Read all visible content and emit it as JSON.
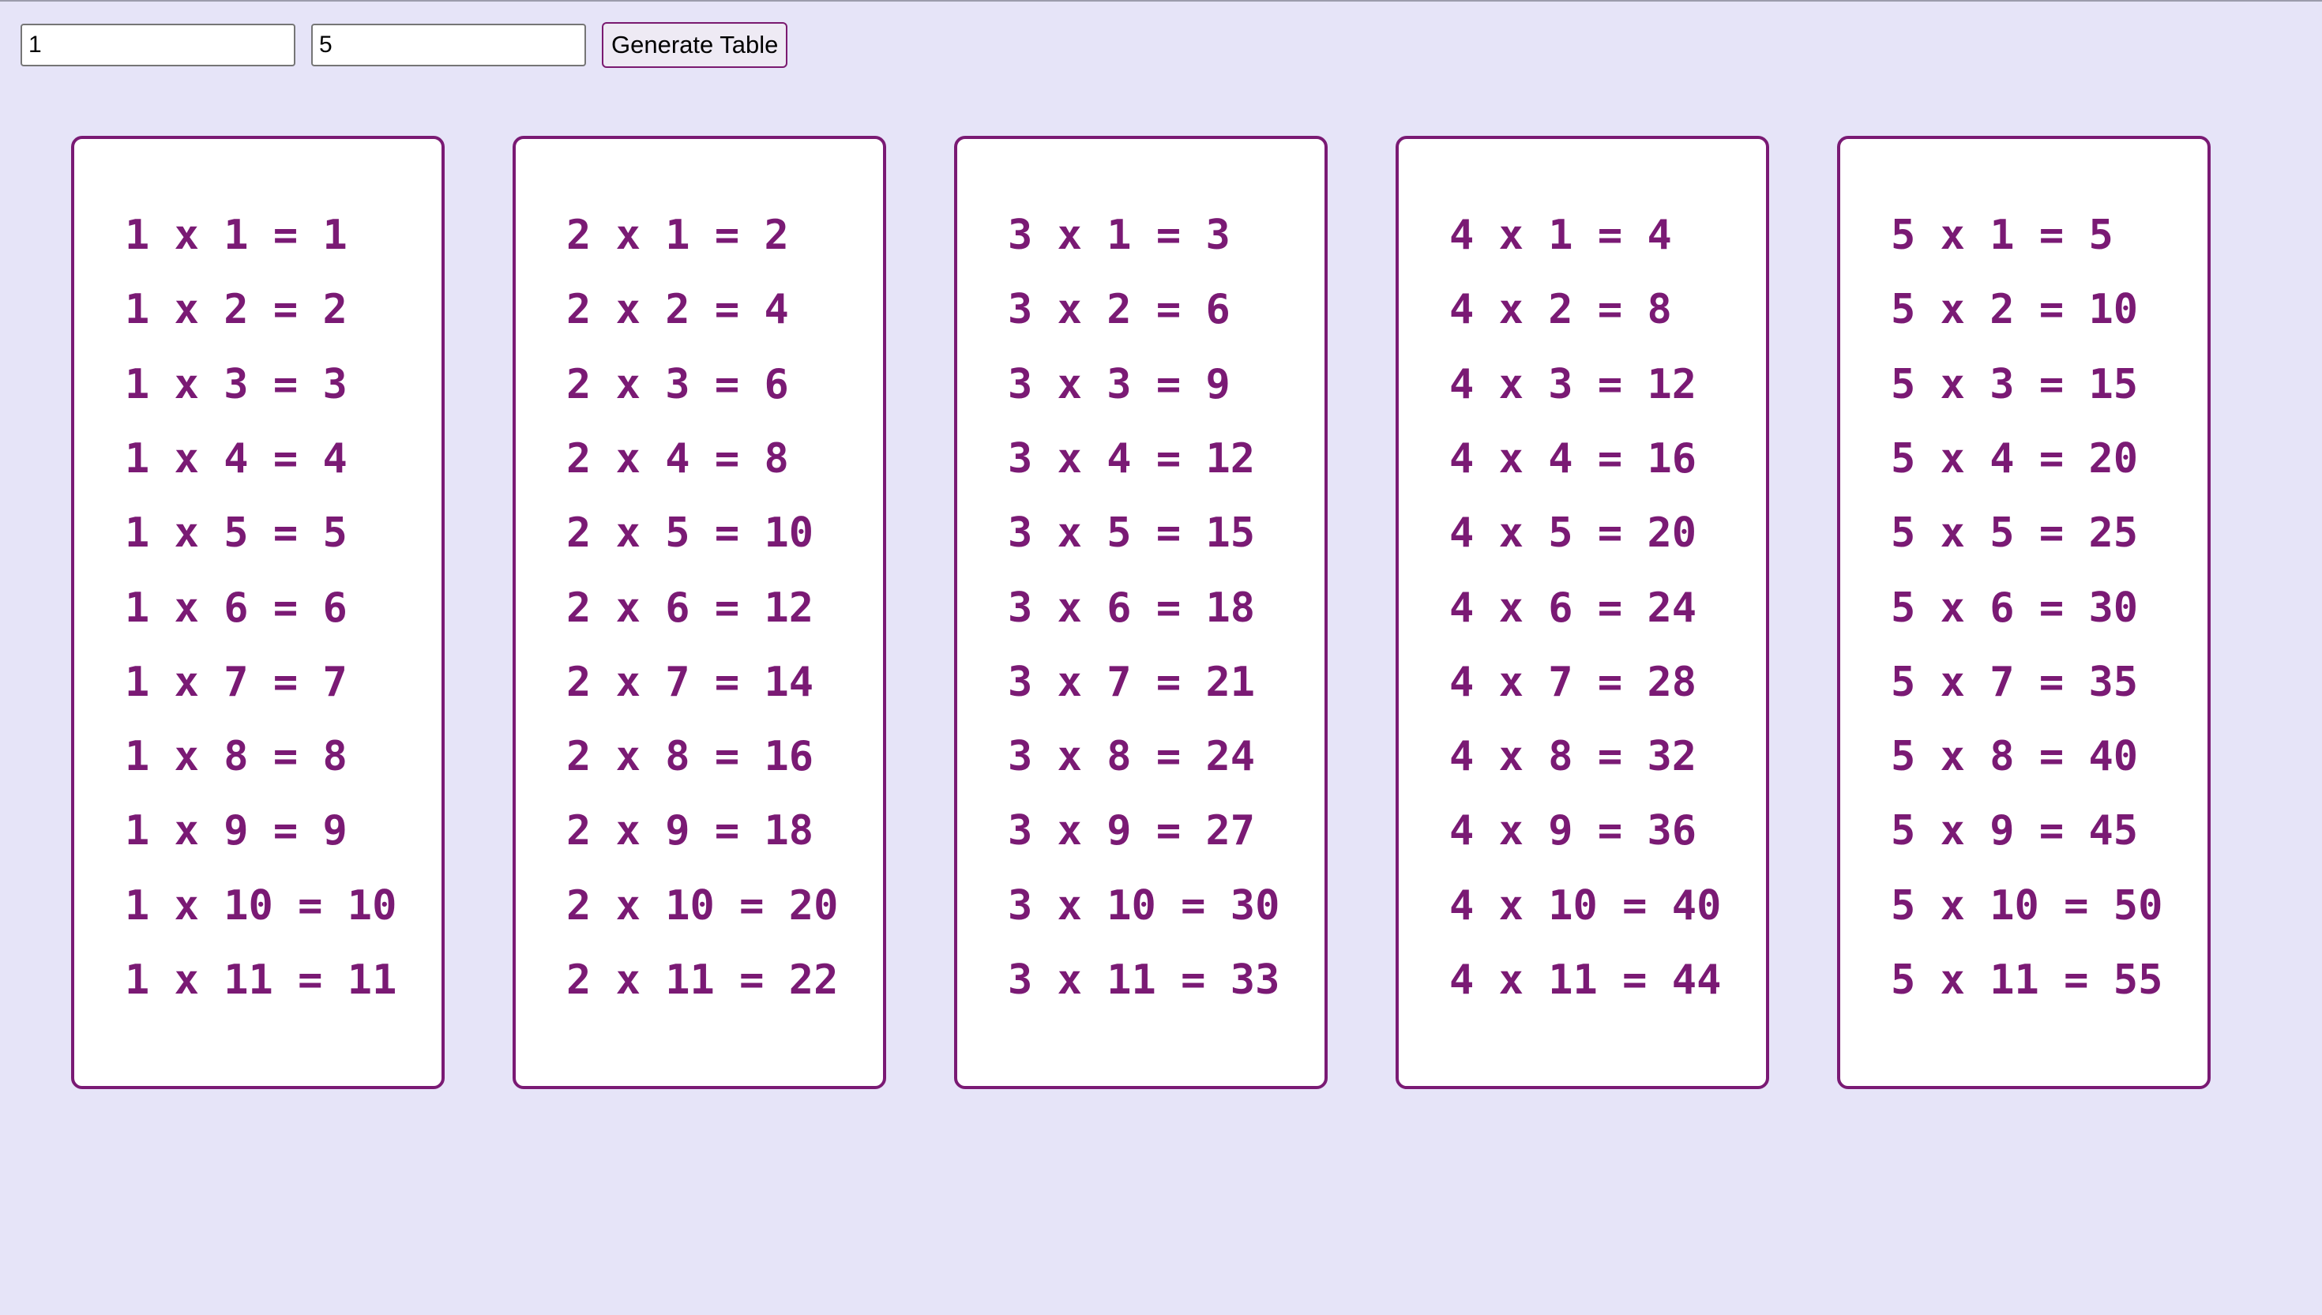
{
  "controls": {
    "start_value": "1",
    "end_value": "5",
    "generate_label": "Generate Table"
  },
  "tables": [
    {
      "multiplicand": 1,
      "rows": [
        "1 x 1 = 1",
        "1 x 2 = 2",
        "1 x 3 = 3",
        "1 x 4 = 4",
        "1 x 5 = 5",
        "1 x 6 = 6",
        "1 x 7 = 7",
        "1 x 8 = 8",
        "1 x 9 = 9",
        "1 x 10 = 10",
        "1 x 11 = 11"
      ]
    },
    {
      "multiplicand": 2,
      "rows": [
        "2 x 1 = 2",
        "2 x 2 = 4",
        "2 x 3 = 6",
        "2 x 4 = 8",
        "2 x 5 = 10",
        "2 x 6 = 12",
        "2 x 7 = 14",
        "2 x 8 = 16",
        "2 x 9 = 18",
        "2 x 10 = 20",
        "2 x 11 = 22"
      ]
    },
    {
      "multiplicand": 3,
      "rows": [
        "3 x 1 = 3",
        "3 x 2 = 6",
        "3 x 3 = 9",
        "3 x 4 = 12",
        "3 x 5 = 15",
        "3 x 6 = 18",
        "3 x 7 = 21",
        "3 x 8 = 24",
        "3 x 9 = 27",
        "3 x 10 = 30",
        "3 x 11 = 33"
      ]
    },
    {
      "multiplicand": 4,
      "rows": [
        "4 x 1 = 4",
        "4 x 2 = 8",
        "4 x 3 = 12",
        "4 x 4 = 16",
        "4 x 5 = 20",
        "4 x 6 = 24",
        "4 x 7 = 28",
        "4 x 8 = 32",
        "4 x 9 = 36",
        "4 x 10 = 40",
        "4 x 11 = 44"
      ]
    },
    {
      "multiplicand": 5,
      "rows": [
        "5 x 1 = 5",
        "5 x 2 = 10",
        "5 x 3 = 15",
        "5 x 4 = 20",
        "5 x 5 = 25",
        "5 x 6 = 30",
        "5 x 7 = 35",
        "5 x 8 = 40",
        "5 x 9 = 45",
        "5 x 10 = 50",
        "5 x 11 = 55"
      ]
    }
  ],
  "colors": {
    "background": "#e6e4f8",
    "accent": "#7a1a74",
    "card": "#ffffff"
  }
}
